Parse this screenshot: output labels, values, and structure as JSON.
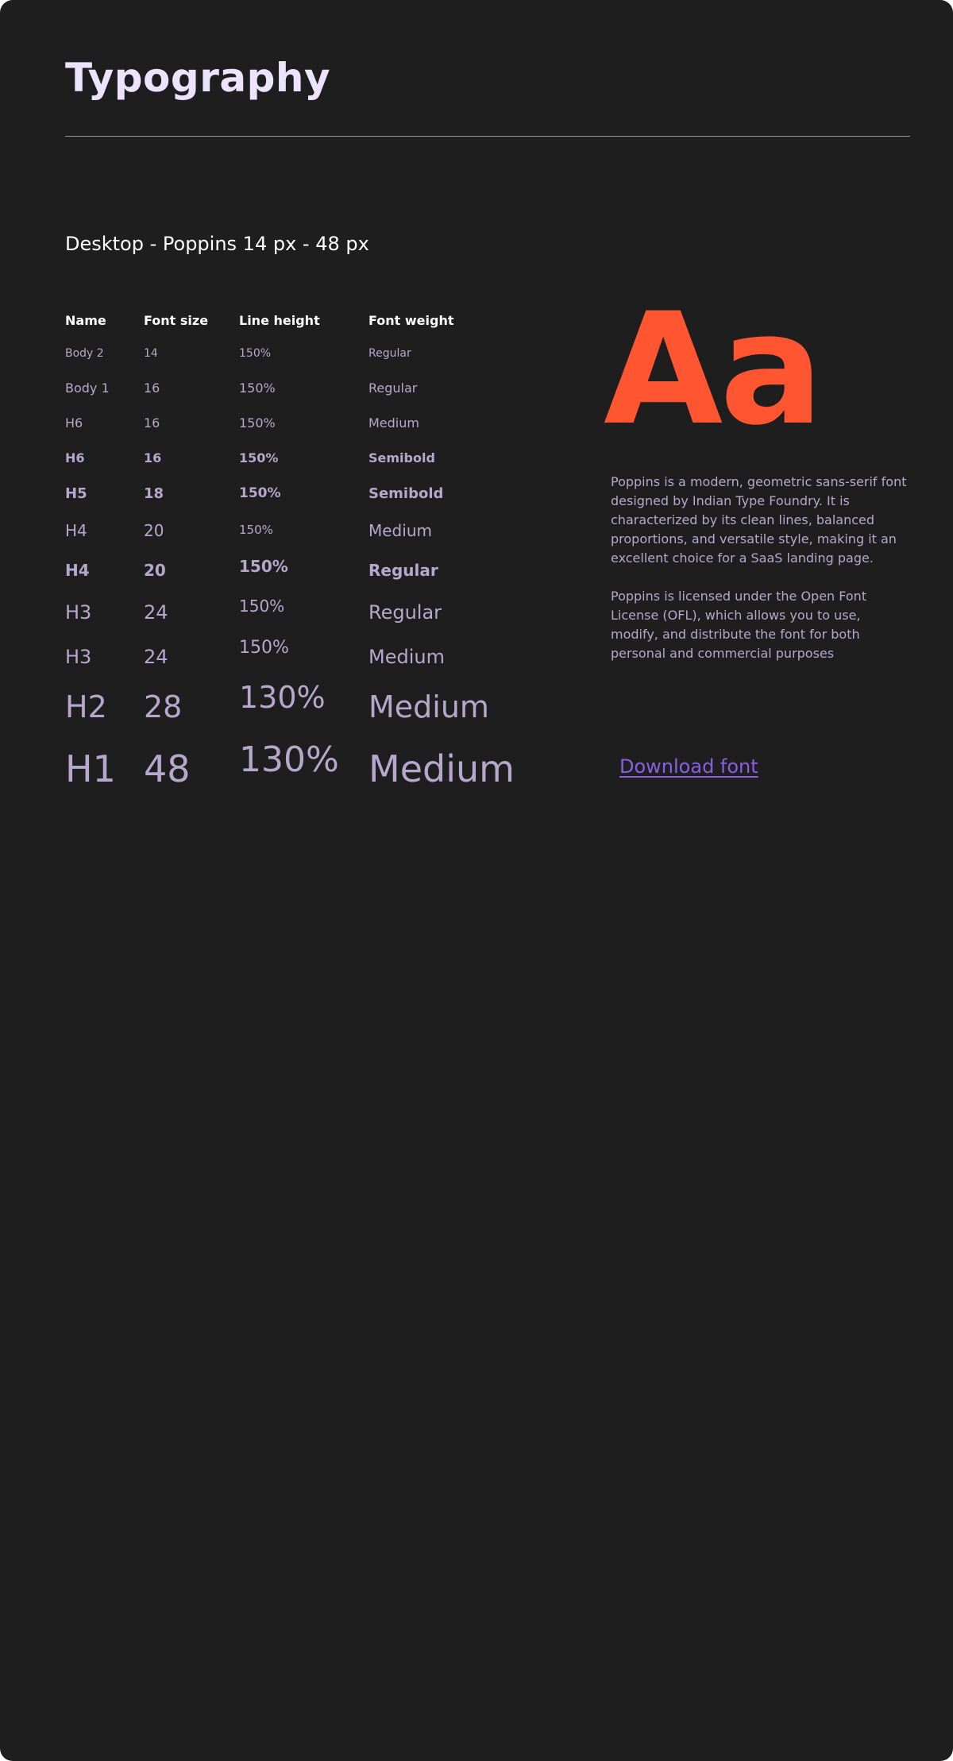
{
  "header": {
    "title": "Typography"
  },
  "section": {
    "heading": "Desktop - Poppins 14 px - 48 px"
  },
  "table": {
    "columns": [
      "Name",
      "Font size",
      "Line height",
      "Font weight"
    ],
    "rows": [
      {
        "name": "Body 2",
        "size": "14",
        "line": "150%",
        "weight": "Regular"
      },
      {
        "name": "Body 1",
        "size": "16",
        "line": "150%",
        "weight": "Regular"
      },
      {
        "name": "H6",
        "size": "16",
        "line": "150%",
        "weight": "Medium"
      },
      {
        "name": "H6",
        "size": "16",
        "line": "150%",
        "weight": "Semibold"
      },
      {
        "name": "H5",
        "size": "18",
        "line": "150%",
        "weight": "Semibold"
      },
      {
        "name": "H4",
        "size": "20",
        "line": "150%",
        "weight": "Medium"
      },
      {
        "name": "H4",
        "size": "20",
        "line": "150%",
        "weight": "Regular"
      },
      {
        "name": "H3",
        "size": "24",
        "line": "150%",
        "weight": "Regular"
      },
      {
        "name": "H3",
        "size": "24",
        "line": "150%",
        "weight": "Medium"
      },
      {
        "name": "H2",
        "size": "28",
        "line": "130%",
        "weight": "Medium"
      },
      {
        "name": "H1",
        "size": "48",
        "line": "130%",
        "weight": "Medium"
      }
    ]
  },
  "specimen": {
    "glyphs": "Aa",
    "color": "#ff5530"
  },
  "description": {
    "paragraph1": "Poppins is a modern, geometric sans-serif font designed by Indian Type Foundry. It is characterized by its clean lines, balanced proportions, and versatile style, making it an excellent choice for a SaaS landing page.",
    "paragraph2": "Poppins is licensed under the Open Font License (OFL), which allows you to use, modify, and distribute the font for both personal and commercial purposes"
  },
  "download": {
    "label": "Download font",
    "color": "#8a5fe3"
  },
  "colors": {
    "background": "#1e1e1e",
    "title": "#ece4ff",
    "text_muted": "#b4a9cc",
    "accent": "#ff5530",
    "link": "#8a5fe3"
  }
}
